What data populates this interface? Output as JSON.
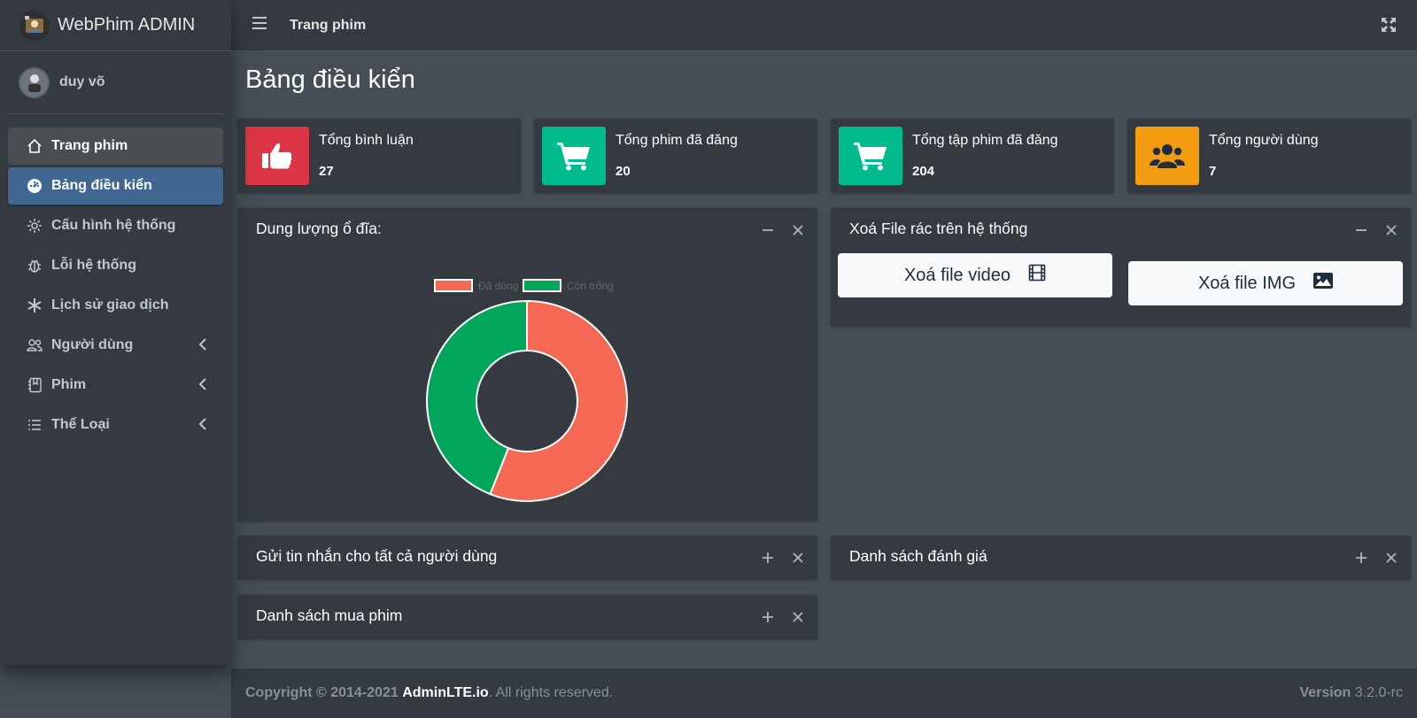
{
  "brand": {
    "name": "WebPhim ADMIN"
  },
  "user": {
    "name": "duy võ"
  },
  "sidebar": {
    "items": [
      {
        "label": "Trang phim",
        "icon": "home-icon"
      },
      {
        "label": "Bảng điều kiển",
        "icon": "dashboard-icon"
      },
      {
        "label": "Cấu hình hệ thống",
        "icon": "gear-icon"
      },
      {
        "label": "Lỗi hệ thống",
        "icon": "bug-icon"
      },
      {
        "label": "Lịch sử giao dịch",
        "icon": "asterisk-icon"
      },
      {
        "label": "Người dùng",
        "icon": "users-icon"
      },
      {
        "label": "Phim",
        "icon": "journal-bookmark-icon"
      },
      {
        "label": "Thể Loại",
        "icon": "list-icon"
      }
    ]
  },
  "header": {
    "title": "Trang phim"
  },
  "page": {
    "title": "Bảng điều kiển"
  },
  "stats": [
    {
      "label": "Tổng bình luận",
      "value": "27",
      "color": "#dc3545",
      "icon": "thumbs-up-icon"
    },
    {
      "label": "Tổng phim đã đăng",
      "value": "20",
      "color": "#00bc8c",
      "icon": "cart-icon"
    },
    {
      "label": "Tổng tập phim đã đăng",
      "value": "204",
      "color": "#00bc8c",
      "icon": "cart-icon"
    },
    {
      "label": "Tổng người dùng",
      "value": "7",
      "color": "#f39c12",
      "icon": "users-icon"
    }
  ],
  "disk_card": {
    "title": "Dung lượng ổ đĩa:"
  },
  "trash_card": {
    "title": "Xoá File rác trên hệ thống",
    "video_button": "Xoá file video",
    "img_button": "Xoá file IMG"
  },
  "message_card": {
    "title": "Gửi tin nhắn cho tất cả người dùng"
  },
  "review_card": {
    "title": "Danh sách đánh giá"
  },
  "purchase_card": {
    "title": "Danh sách mua phim"
  },
  "chart_data": {
    "type": "pie",
    "categories": [
      "Đã dùng",
      "Còn trống"
    ],
    "values": [
      56,
      44
    ],
    "colors": [
      "#f56954",
      "#00a65a"
    ],
    "legend_position": "top"
  },
  "footer": {
    "copyright": "Copyright © 2014-2021",
    "brand": "AdminLTE.io",
    "rights": ". All rights reserved.",
    "version_label": "Version",
    "version": "3.2.0-rc"
  }
}
